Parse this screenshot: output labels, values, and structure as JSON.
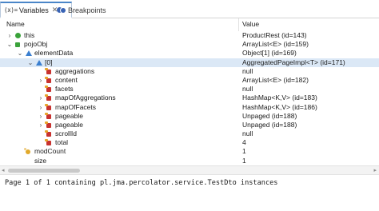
{
  "tabs": [
    {
      "glyph": "(x)=",
      "label": "Variables",
      "close": "✕",
      "active": true
    },
    {
      "label": "Breakpoints",
      "active": false
    }
  ],
  "columns": {
    "name": "Name",
    "value": "Value"
  },
  "rows": [
    {
      "indent": 0,
      "expander": "›",
      "icon": "green",
      "name": "this",
      "value": "ProductRest  (id=143)"
    },
    {
      "indent": 0,
      "expander": "⌄",
      "icon": "green-sq",
      "name": "pojoObj",
      "value": "ArrayList<E>  (id=159)"
    },
    {
      "indent": 1,
      "expander": "⌄",
      "icon": "blue-tri",
      "name": "elementData",
      "value": "Object[1]  (id=169)"
    },
    {
      "indent": 2,
      "expander": "⌄",
      "icon": "blue-tri",
      "name": "[0]",
      "value": "AggregatedPageImpl<T>  (id=171)",
      "selected": true
    },
    {
      "indent": 3,
      "expander": "",
      "icon": "red-sq",
      "name": "aggregations",
      "value": "null"
    },
    {
      "indent": 3,
      "expander": "›",
      "icon": "red-sq",
      "name": "content",
      "value": "ArrayList<E>  (id=182)"
    },
    {
      "indent": 3,
      "expander": "",
      "icon": "red-sq",
      "name": "facets",
      "value": "null"
    },
    {
      "indent": 3,
      "expander": "›",
      "icon": "red-sq",
      "name": "mapOfAggregations",
      "value": "HashMap<K,V>  (id=183)"
    },
    {
      "indent": 3,
      "expander": "›",
      "icon": "red-sq",
      "name": "mapOfFacets",
      "value": "HashMap<K,V>  (id=186)"
    },
    {
      "indent": 3,
      "expander": "›",
      "icon": "red-sq",
      "name": "pageable",
      "value": "Unpaged  (id=188)"
    },
    {
      "indent": 3,
      "expander": "›",
      "icon": "red-sq",
      "name": "pageable",
      "value": "Unpaged  (id=188)"
    },
    {
      "indent": 3,
      "expander": "",
      "icon": "red-sq",
      "name": "scrollId",
      "value": "null"
    },
    {
      "indent": 3,
      "expander": "",
      "icon": "red-sq",
      "name": "total",
      "value": "4"
    },
    {
      "indent": 1,
      "expander": "",
      "icon": "yellow",
      "name": "modCount",
      "value": "1"
    },
    {
      "indent": 1,
      "expander": "",
      "icon": "",
      "name": "size",
      "value": "1"
    }
  ],
  "details": "Page 1 of 1 containing pl.jma.percolator.service.TestDto instances",
  "colors": {
    "selection": "#dbe8f6",
    "tab_accent": "#4a86c8"
  }
}
